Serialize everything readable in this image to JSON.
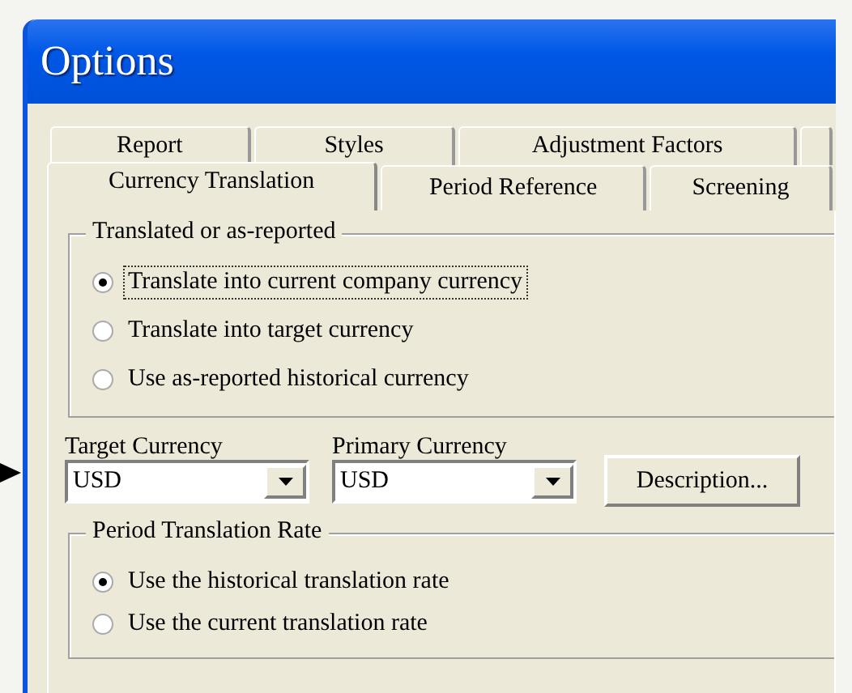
{
  "window": {
    "title": "Options"
  },
  "tab_rows": [
    [
      {
        "label": "Report",
        "selected": false
      },
      {
        "label": "Styles",
        "selected": false
      },
      {
        "label": "Adjustment Factors",
        "selected": false
      }
    ],
    [
      {
        "label": "Currency Translation",
        "selected": true
      },
      {
        "label": "Period Reference",
        "selected": false
      },
      {
        "label": "Screening",
        "selected": false
      }
    ]
  ],
  "translated_group": {
    "title": "Translated or as-reported",
    "options": [
      {
        "label": "Translate into current company currency",
        "selected": true
      },
      {
        "label": "Translate into target currency",
        "selected": false
      },
      {
        "label": "Use as-reported historical currency",
        "selected": false
      }
    ]
  },
  "target_currency": {
    "label": "Target Currency",
    "value": "USD"
  },
  "primary_currency": {
    "label": "Primary Currency",
    "value": "USD"
  },
  "description_button": "Description...",
  "rate_group": {
    "title": "Period  Translation Rate",
    "options": [
      {
        "label": "Use the historical translation rate",
        "selected": true
      },
      {
        "label": "Use the current translation rate",
        "selected": false
      }
    ]
  }
}
